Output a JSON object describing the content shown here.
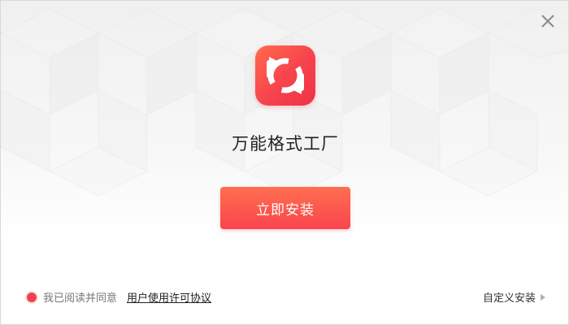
{
  "app": {
    "title": "万能格式工厂"
  },
  "install": {
    "button_label": "立即安装"
  },
  "footer": {
    "agree_text": "我已阅读并同意",
    "agreement_link": "用户使用许可协议",
    "custom_install": "自定义安装"
  },
  "colors": {
    "accent": "#f6434d",
    "accent_light": "#ff6f4f"
  },
  "icons": {
    "close": "close-icon",
    "logo": "refresh-arrows-icon",
    "arrow": "triangle-right-icon"
  }
}
